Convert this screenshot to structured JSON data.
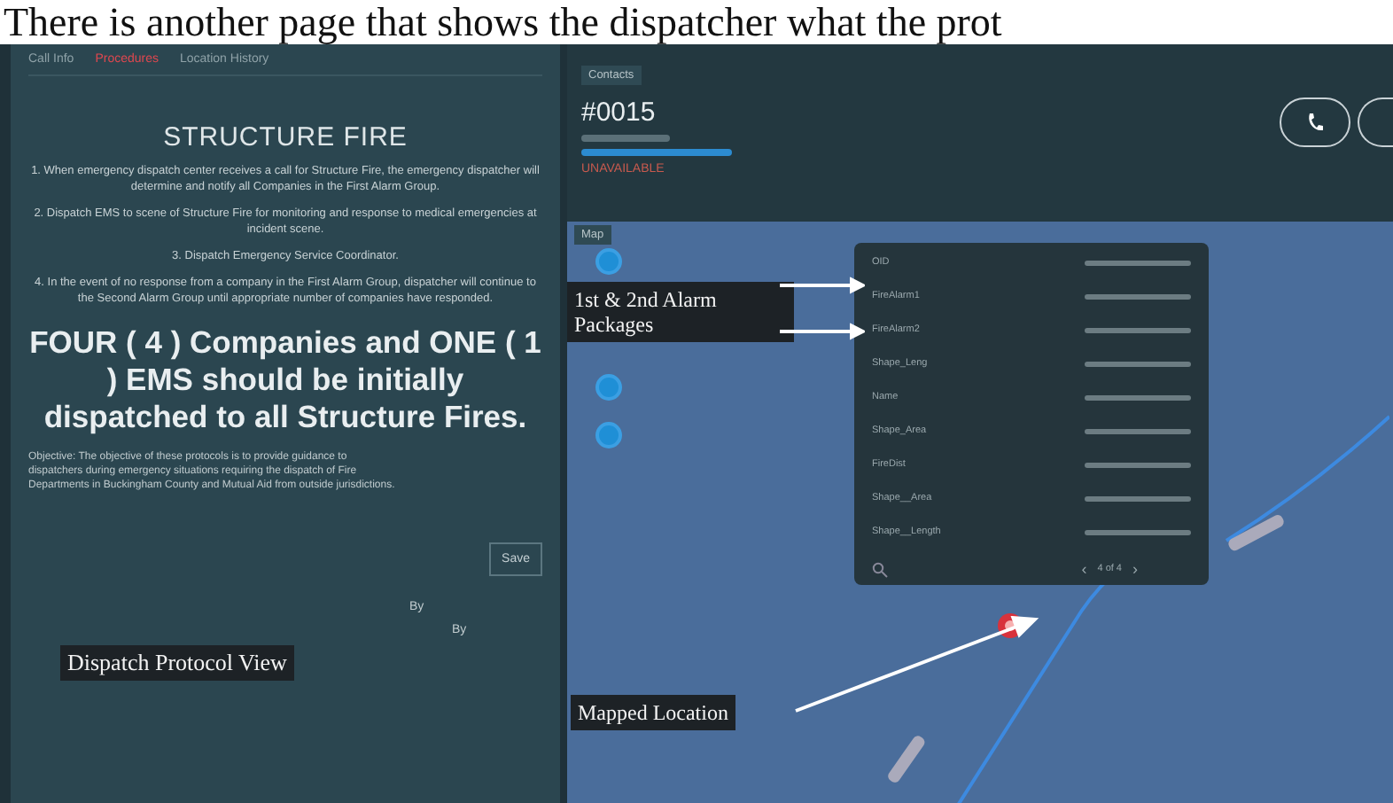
{
  "document_text": "There is another page that shows the dispatcher what the prot",
  "left_panel": {
    "tabs": [
      {
        "label": "Call Info",
        "selected": false
      },
      {
        "label": "Procedures",
        "selected": true
      },
      {
        "label": "Location History",
        "selected": false
      }
    ],
    "title": "STRUCTURE FIRE",
    "steps": [
      "1. When emergency dispatch center receives a call for Structure Fire, the emergency dispatcher will determine and notify all Companies in the First Alarm Group.",
      "2. Dispatch EMS to scene of Structure Fire for monitoring and response to medical emergencies at incident scene.",
      "3. Dispatch Emergency Service Coordinator.",
      "4. In the event of no response from a company in the First Alarm Group, dispatcher will continue to the Second Alarm Group until appropriate number of companies have responded."
    ],
    "headline": "FOUR ( 4 ) Companies and ONE ( 1 ) EMS should be initially dispatched to all Structure Fires.",
    "objective": "Objective: The objective of these protocols is to provide guidance to dispatchers during emergency situations requiring the dispatch of Fire Departments in Buckingham County and Mutual Aid from outside jurisdictions.",
    "save_button": "Save",
    "footer_labels": [
      "By",
      "By"
    ]
  },
  "call_panel": {
    "tab": "Contacts",
    "call_number": "#0015",
    "status": "UNAVAILABLE"
  },
  "map_panel": {
    "tab": "Map",
    "popup": {
      "rows": [
        {
          "key": "OID"
        },
        {
          "key": "FireAlarm1"
        },
        {
          "key": "FireAlarm2"
        },
        {
          "key": "Shape_Leng"
        },
        {
          "key": "Name"
        },
        {
          "key": "Shape_Area"
        },
        {
          "key": "FireDist"
        },
        {
          "key": "Shape__Area"
        },
        {
          "key": "Shape__Length"
        }
      ],
      "prev": "‹",
      "pager": "4 of 4",
      "next": "›"
    }
  },
  "annotations": [
    {
      "text": "1st & 2nd Alarm Packages",
      "kind": "alarm"
    },
    {
      "text": "Dispatch Protocol View",
      "kind": "protocol"
    },
    {
      "text": "Mapped Location",
      "kind": "location"
    }
  ]
}
